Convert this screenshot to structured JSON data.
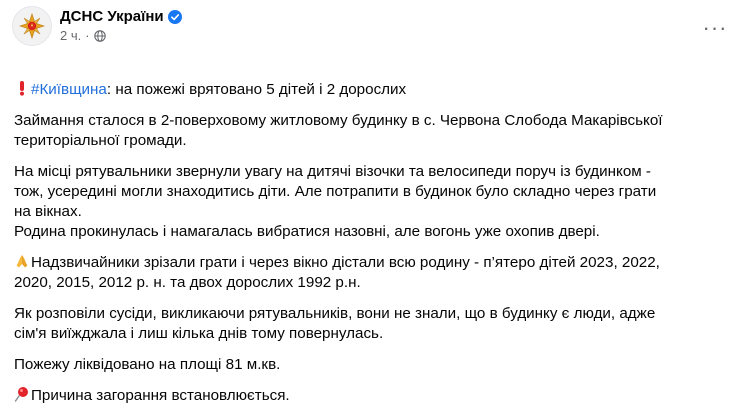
{
  "post": {
    "author": "ДСНС України",
    "time": "2 ч.",
    "time_separator": "·",
    "more_label": "···",
    "intro_hashtag": "#Київщина",
    "intro_text": ": на пожежі врятовано 5 дітей і 2 дорослих",
    "paragraphs": [
      "Займання сталося в 2-поверховому житловому будинку в с. Червона Слобода Макарівської\nтериторіальної громади.",
      "На місці рятувальники звернули увагу на дитячі візочки та велосипеди поруч із будинком -\nтож, усередині могли знаходитись діти. Але потрапити в будинок було складно через грати\nна вікнах.\nРодина прокинулась і намагалась вибратися назовні, але вогонь уже охопив двері."
    ],
    "pray_paragraph": "Надзвичайники зрізали грати і через вікно дістали всю родину - п’ятеро дітей 2023, 2022,\n2020, 2015, 2012 р. н. та двох дорослих 1992 р.н.",
    "paragraphs_after": [
      "Як розповіли сусіди, викликаючи рятувальників, вони не знали, що в будинку є люди, адже\nсім'я виїжджала і лиш кілька днів тому повернулась.",
      "Пожежу ліквідовано на площі 81 м.кв."
    ],
    "pin_paragraph": "Причина загорання встановлюється."
  },
  "icons": {
    "avatar": "dsns-emblem-icon",
    "verified": "verified-badge-icon",
    "privacy": "globe-icon",
    "exclamation": "exclamation-emoji-icon",
    "pray": "folded-hands-emoji-icon",
    "pin": "round-pushpin-emoji-icon"
  },
  "colors": {
    "verified": "#1877f2",
    "hashtag": "#216fdb",
    "secondary_text": "#65676b",
    "avatar_emblem": "#e8a21d"
  }
}
